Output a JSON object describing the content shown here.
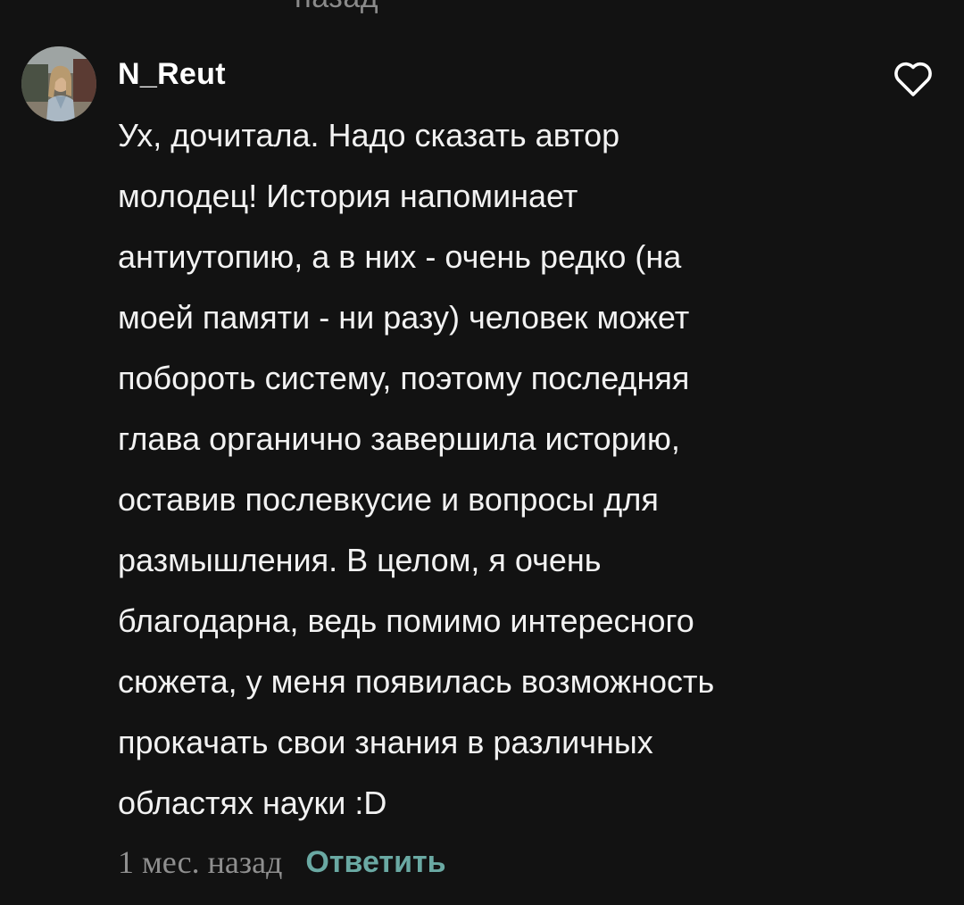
{
  "cut_off_text": "назад",
  "comment": {
    "username": "N_Reut",
    "body_lines": [
      "Ух, дочитала. Надо сказать автор",
      "молодец! История напоминает",
      "антиутопию, а в них - очень редко (на",
      "моей памяти - ни разу) человек может",
      "побороть систему, поэтому последняя",
      "глава органично завершила историю,",
      "оставив послевкусие и вопросы для",
      "размышления. В целом, я очень",
      "благодарна, ведь помимо интересного",
      "сюжета, у меня появилась возможность",
      "прокачать свои знания в различных",
      "областях науки :D"
    ],
    "timestamp": "1 мес. назад",
    "reply_label": "Ответить"
  },
  "icons": {
    "like": "heart-outline-icon",
    "avatar": "user-avatar-photo"
  },
  "colors": {
    "background": "#121212",
    "text": "#f2f2f2",
    "muted": "#8f8f8f",
    "accent": "#6aa9a3"
  }
}
